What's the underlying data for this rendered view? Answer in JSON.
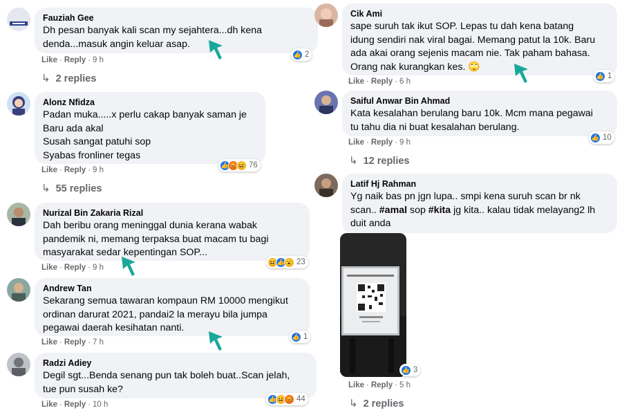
{
  "comments": [
    {
      "author": "Fauziah Gee",
      "text": "Dh pesan banyak kali scan my sejahtera...dh kena\ndenda...masuk angin keluar asap.",
      "like": "Like",
      "reply": "Reply",
      "time": "9 h",
      "reaction_count": "2",
      "replies": "2 replies"
    },
    {
      "author": "Alonz Nfidza",
      "text": "Padan muka.....x perlu cakap banyak saman je\nBaru ada akal\nSusah sangat patuhi sop\nSyabas fronliner tegas",
      "like": "Like",
      "reply": "Reply",
      "time": "9 h",
      "reaction_count": "76",
      "replies": "55 replies"
    },
    {
      "author": "Nurizal Bin Zakaria Rizal",
      "text": "Dah beribu orang meninggal dunia kerana wabak\npandemik ni, memang terpaksa buat macam tu bagi\nmasyarakat sedar kepentingan SOP...",
      "like": "Like",
      "reply": "Reply",
      "time": "9 h",
      "reaction_count": "23"
    },
    {
      "author": "Andrew Tan",
      "text": "Sekarang semua tawaran kompaun RM 10000 mengikut\nordinan darurat 2021, pandai2 la merayu bila jumpa\npegawai daerah kesihatan nanti.",
      "like": "Like",
      "reply": "Reply",
      "time": "7 h",
      "reaction_count": "1"
    },
    {
      "author": "Radzi Adiey",
      "text": "Degil sgt...Benda senang pun tak boleh buat..Scan jelah,\ntue pun susah ke?",
      "like": "Like",
      "reply": "Reply",
      "time": "10 h",
      "reaction_count": "44"
    },
    {
      "author": "Cik Ami",
      "text": "sape suruh tak ikut SOP. Lepas tu dah kena batang\nidung sendiri nak viral bagai. Memang patut la 10k. Baru\nada akai orang sejenis macam nie. Tak paham bahasa.\nOrang nak kurangkan kes. 🙄",
      "like": "Like",
      "reply": "Reply",
      "time": "6 h",
      "reaction_count": "1"
    },
    {
      "author": "Saiful Anwar Bin Ahmad",
      "text": "Kata kesalahan berulang baru 10k. Mcm mana pegawai\ntu tahu dia ni buat kesalahan berulang.",
      "like": "Like",
      "reply": "Reply",
      "time": "9 h",
      "reaction_count": "10",
      "replies": "12 replies"
    },
    {
      "author": "Latif Hj Rahman",
      "text_a": "Yg naik bas pn jgn lupa.. smpi kena suruh scan br nk\nscan.. ",
      "tag1": "#amal",
      "text_b": " sop ",
      "tag2": "#kita",
      "text_c": " jg kita.. kalau tidak melayang2 lh\nduit anda",
      "like": "Like",
      "reply": "Reply",
      "time": "5 h",
      "reaction_count": "3",
      "replies": "2 replies"
    }
  ],
  "icons": {
    "like": "like-reaction-icon",
    "angry": "angry-reaction-icon",
    "haha": "haha-reaction-icon",
    "wow": "wow-reaction-icon",
    "cursor": "pointer-arrow-icon",
    "reply_arrow": "reply-arrow-icon"
  },
  "colors": {
    "bubble": "#f0f2f5",
    "like_blue": "#1877f2",
    "meta_gray": "#65676b",
    "cursor_teal": "#1aa89a"
  }
}
